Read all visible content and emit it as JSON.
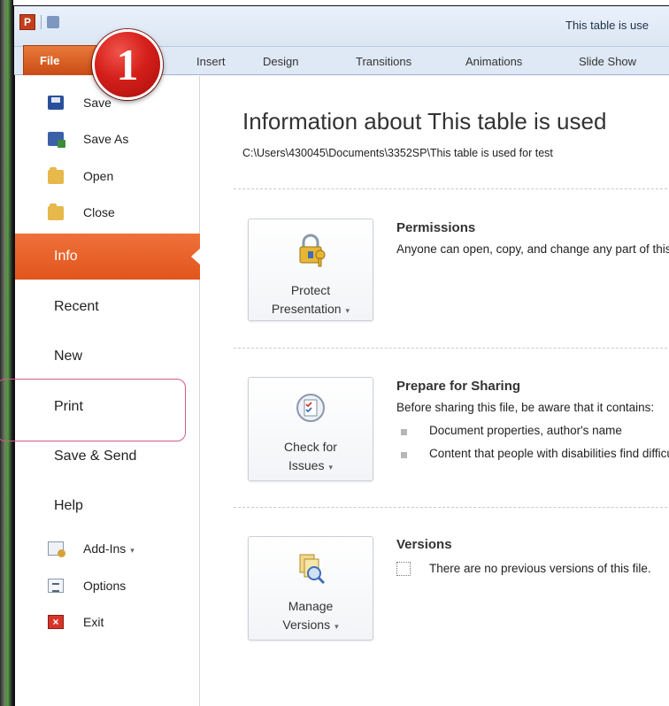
{
  "window": {
    "title": "This table is use",
    "app_icon": "P"
  },
  "ribbon": {
    "file_tab": "File",
    "tabs": [
      "Insert",
      "Design",
      "Transitions",
      "Animations",
      "Slide Show"
    ]
  },
  "callout": {
    "number": "1"
  },
  "backstage_menu": {
    "items": [
      {
        "label": "Save",
        "icon": "save-icon"
      },
      {
        "label": "Save As",
        "icon": "save-as-icon"
      },
      {
        "label": "Open",
        "icon": "folder-open-icon"
      },
      {
        "label": "Close",
        "icon": "folder-close-icon"
      },
      {
        "label": "Info",
        "active": true
      },
      {
        "label": "Recent"
      },
      {
        "label": "New"
      },
      {
        "label": "Print"
      },
      {
        "label": "Save & Send"
      },
      {
        "label": "Help"
      },
      {
        "label": "Add-Ins",
        "icon": "add-ins-icon",
        "dropdown": "▾"
      },
      {
        "label": "Options",
        "icon": "options-icon"
      },
      {
        "label": "Exit",
        "icon": "exit-icon"
      }
    ]
  },
  "info": {
    "title": "Information about This table is used",
    "path": "C:\\Users\\430045\\Documents\\3352SP\\This table is used for test"
  },
  "permissions": {
    "button_line1": "Protect",
    "button_line2": "Presentation",
    "heading": "Permissions",
    "text": "Anyone can open, copy, and change any part of this presentation."
  },
  "sharing": {
    "button_line1": "Check for",
    "button_line2": "Issues",
    "heading": "Prepare for Sharing",
    "text": "Before sharing this file, be aware that it contains:",
    "bullets": [
      "Document properties, author's name",
      "Content that people with disabilities find difficult to read"
    ]
  },
  "versions": {
    "button_line1": "Manage",
    "button_line2": "Versions",
    "heading": "Versions",
    "text": "There are no previous versions of this file."
  },
  "colors": {
    "accent": "#e0561d",
    "callout": "#d51f1a",
    "highlight_outline": "#d15a89"
  }
}
